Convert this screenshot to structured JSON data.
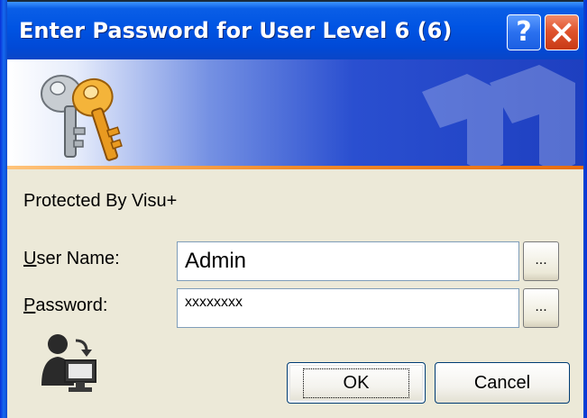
{
  "window": {
    "title": "Enter Password for User Level 6 (6)",
    "help_glyph": "?",
    "close_icon": "close-icon"
  },
  "banner": {
    "icon": "keys-icon",
    "watermark": "key-watermark"
  },
  "content": {
    "protected_text": "Protected By Visu+",
    "user_label_first": "U",
    "user_label_rest": "ser Name:",
    "user_value": "Admin",
    "password_label_first": "P",
    "password_label_rest": "assword:",
    "password_value": "xxxxxxxx",
    "browse_label": "...",
    "user_icon": "user-computer-icon"
  },
  "buttons": {
    "ok": "OK",
    "cancel": "Cancel"
  },
  "colors": {
    "titlebar": "#0054e3",
    "dialog_bg": "#ece9d8",
    "close_red": "#e0542e",
    "accent_orange": "#f08a2a"
  }
}
